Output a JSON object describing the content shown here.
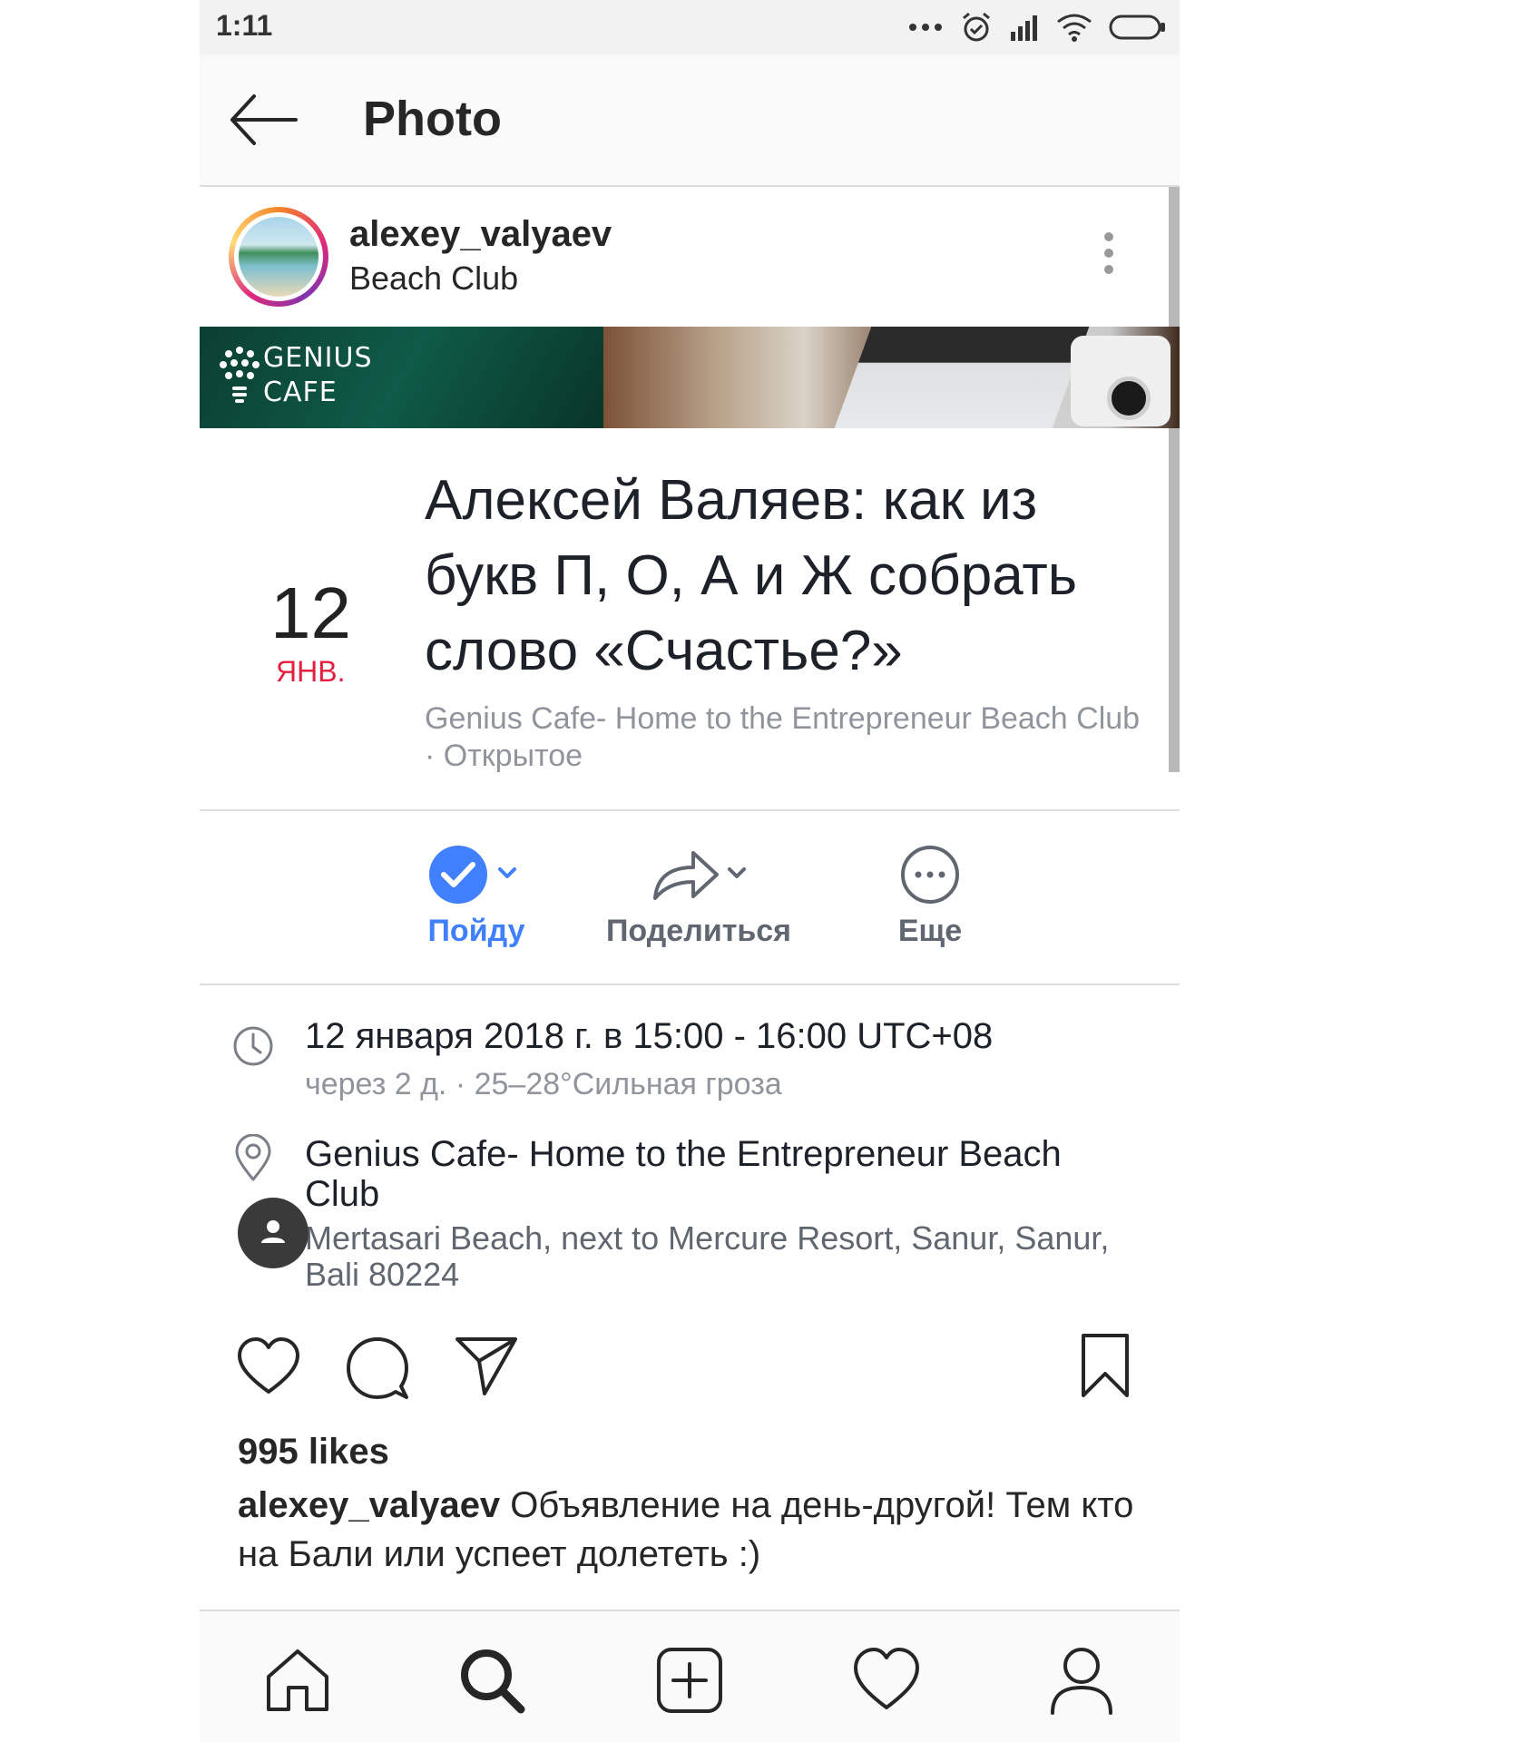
{
  "status_bar": {
    "time": "1:11"
  },
  "header": {
    "title": "Photo"
  },
  "post": {
    "username": "alexey_valyaev",
    "location": "Beach Club",
    "banner_logo_line1": "GENIUS",
    "banner_logo_line2": "CAFE",
    "event": {
      "day": "12",
      "month": "ЯНВ.",
      "title": "Алексей Валяев: как из букв П, О, А и Ж собрать слово «Счастье?»",
      "subtitle": "Genius Cafe- Home to the Entrepreneur Beach Club · Открытое",
      "actions": {
        "going": "Пойду",
        "share": "Поделиться",
        "more": "Еще"
      },
      "datetime": "12 января 2018 г. в 15:00 - 16:00 UTC+08",
      "datetime_sub": "через 2 д. · 25–28°Сильная гроза",
      "place_name": "Genius Cafe- Home to the Entrepreneur Beach Club",
      "place_address": "Mertasari Beach, next to Mercure Resort, Sanur, Sanur, Bali 80224"
    },
    "likes": "995 likes",
    "caption_user": "alexey_valyaev",
    "caption_text": " Объявление на день-другой! Тем кто на Бали или успеет долететь :)"
  },
  "icons": {
    "status": [
      "dots-icon",
      "alarm-icon",
      "signal-icon",
      "wifi-icon",
      "battery-icon"
    ],
    "nav": [
      "home-icon",
      "search-icon",
      "new-post-icon",
      "heart-icon",
      "profile-icon"
    ]
  },
  "colors": {
    "accent_blue": "#4080ff",
    "month_red": "#e41e3f",
    "muted_gray": "#90949c"
  }
}
